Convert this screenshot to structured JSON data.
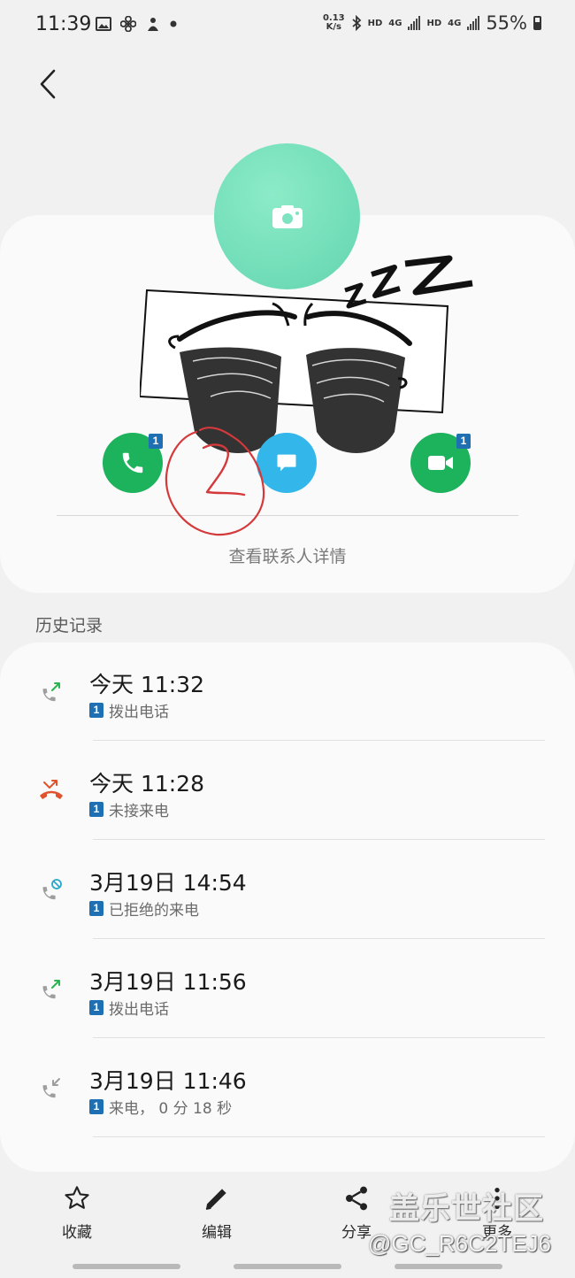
{
  "status_bar": {
    "time": "11:39",
    "net_speed_value": "0.13",
    "net_speed_unit": "K/s",
    "hd1": "HD",
    "net1": "4G",
    "hd2": "HD",
    "net2": "4G",
    "battery": "55%"
  },
  "contact": {
    "view_details": "查看联系人详情",
    "call_badge": "1",
    "video_badge": "1"
  },
  "history": {
    "title": "历史记录",
    "items": [
      {
        "time": "今天 11:32",
        "sim": "1",
        "desc": "拨出电话",
        "type": "outgoing"
      },
      {
        "time": "今天 11:28",
        "sim": "1",
        "desc": "未接来电",
        "type": "missed"
      },
      {
        "time": "3月19日 14:54",
        "sim": "1",
        "desc": "已拒绝的来电",
        "type": "rejected"
      },
      {
        "time": "3月19日 11:56",
        "sim": "1",
        "desc": "拨出电话",
        "type": "outgoing"
      },
      {
        "time": "3月19日 11:46",
        "sim": "1",
        "desc": "来电， 0 分 18 秒",
        "type": "incoming"
      }
    ]
  },
  "toolbar": {
    "favorite": "收藏",
    "edit": "编辑",
    "share": "分享",
    "more": "更多"
  },
  "watermark": {
    "site": "盖乐世社区",
    "user": "@GC_R6C2TEJ6"
  },
  "colors": {
    "call_green": "#1db25c",
    "message_blue": "#33b6ea",
    "avatar_mint": "#7ee3c0",
    "sim_badge": "#1f6fb3",
    "missed_red": "#e0522d"
  }
}
